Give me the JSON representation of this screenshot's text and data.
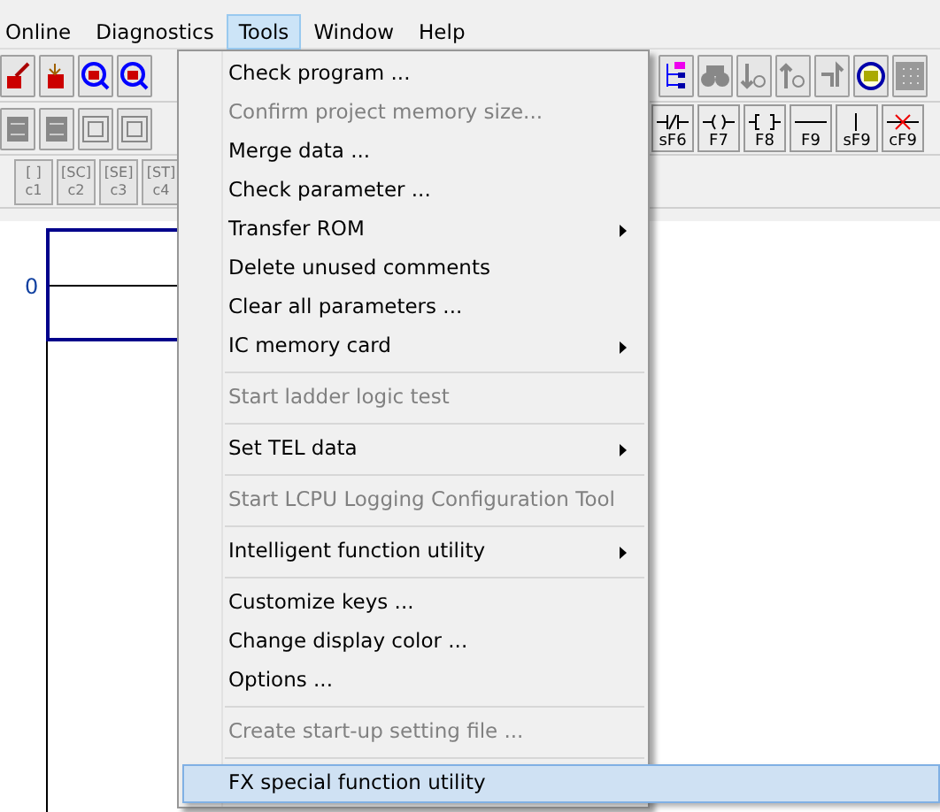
{
  "menu_bar": [
    {
      "label": "Online",
      "selected": false
    },
    {
      "label": "Diagnostics",
      "selected": false
    },
    {
      "label": "Tools",
      "selected": true
    },
    {
      "label": "Window",
      "selected": false
    },
    {
      "label": "Help",
      "selected": false
    }
  ],
  "toolbar_1": {
    "left": [
      {
        "kind": "edit"
      },
      {
        "kind": "transfer"
      },
      {
        "kind": "zoom"
      },
      {
        "kind": "zoom"
      }
    ],
    "right": [
      {
        "kind": "tree"
      },
      {
        "kind": "find"
      },
      {
        "kind": "down"
      },
      {
        "kind": "up"
      },
      {
        "kind": "swap"
      },
      {
        "kind": "device"
      },
      {
        "kind": "grid"
      }
    ]
  },
  "toolbar_2": {
    "left": [
      {
        "kind": "block"
      },
      {
        "kind": "block"
      },
      {
        "kind": "box"
      },
      {
        "kind": "box"
      }
    ],
    "right": [
      {
        "label": "sF6",
        "kind": "nc"
      },
      {
        "label": "F7",
        "kind": "coil"
      },
      {
        "label": "F8",
        "kind": "func"
      },
      {
        "label": "F9",
        "kind": "hline"
      },
      {
        "label": "sF9",
        "kind": "vline"
      },
      {
        "label": "cF9",
        "kind": "hdel"
      }
    ]
  },
  "toolbar_3": [
    {
      "label": "c1",
      "glyph": "[ ]"
    },
    {
      "label": "c2",
      "glyph": "[SC]"
    },
    {
      "label": "c3",
      "glyph": "[SE]"
    },
    {
      "label": "c4",
      "glyph": "[ST]"
    }
  ],
  "ladder": {
    "step": "0"
  },
  "tools_menu": [
    {
      "kind": "item",
      "label": "Check program ...",
      "disabled": false,
      "submenu": false,
      "selected": false
    },
    {
      "kind": "item",
      "label": "Confirm project memory size...",
      "disabled": true,
      "submenu": false,
      "selected": false
    },
    {
      "kind": "item",
      "label": "Merge data ...",
      "disabled": false,
      "submenu": false,
      "selected": false
    },
    {
      "kind": "item",
      "label": "Check parameter ...",
      "disabled": false,
      "submenu": false,
      "selected": false
    },
    {
      "kind": "item",
      "label": "Transfer ROM",
      "disabled": false,
      "submenu": true,
      "selected": false
    },
    {
      "kind": "item",
      "label": "Delete unused comments",
      "disabled": false,
      "submenu": false,
      "selected": false
    },
    {
      "kind": "item",
      "label": "Clear all parameters ...",
      "disabled": false,
      "submenu": false,
      "selected": false
    },
    {
      "kind": "item",
      "label": "IC memory card",
      "disabled": false,
      "submenu": true,
      "selected": false
    },
    {
      "kind": "separator"
    },
    {
      "kind": "item",
      "label": "Start ladder logic test",
      "disabled": true,
      "submenu": false,
      "selected": false
    },
    {
      "kind": "separator"
    },
    {
      "kind": "item",
      "label": "Set TEL data",
      "disabled": false,
      "submenu": true,
      "selected": false
    },
    {
      "kind": "separator"
    },
    {
      "kind": "item",
      "label": "Start LCPU Logging Configuration Tool",
      "disabled": true,
      "submenu": false,
      "selected": false
    },
    {
      "kind": "separator"
    },
    {
      "kind": "item",
      "label": "Intelligent function utility",
      "disabled": false,
      "submenu": true,
      "selected": false
    },
    {
      "kind": "separator"
    },
    {
      "kind": "item",
      "label": "Customize keys ...",
      "disabled": false,
      "submenu": false,
      "selected": false
    },
    {
      "kind": "item",
      "label": "Change display color ...",
      "disabled": false,
      "submenu": false,
      "selected": false
    },
    {
      "kind": "item",
      "label": "Options ...",
      "disabled": false,
      "submenu": false,
      "selected": false
    },
    {
      "kind": "separator"
    },
    {
      "kind": "item",
      "label": "Create start-up setting file ...",
      "disabled": true,
      "submenu": false,
      "selected": false
    },
    {
      "kind": "separator"
    },
    {
      "kind": "item",
      "label": "FX special function utility",
      "disabled": false,
      "submenu": false,
      "selected": true
    }
  ]
}
